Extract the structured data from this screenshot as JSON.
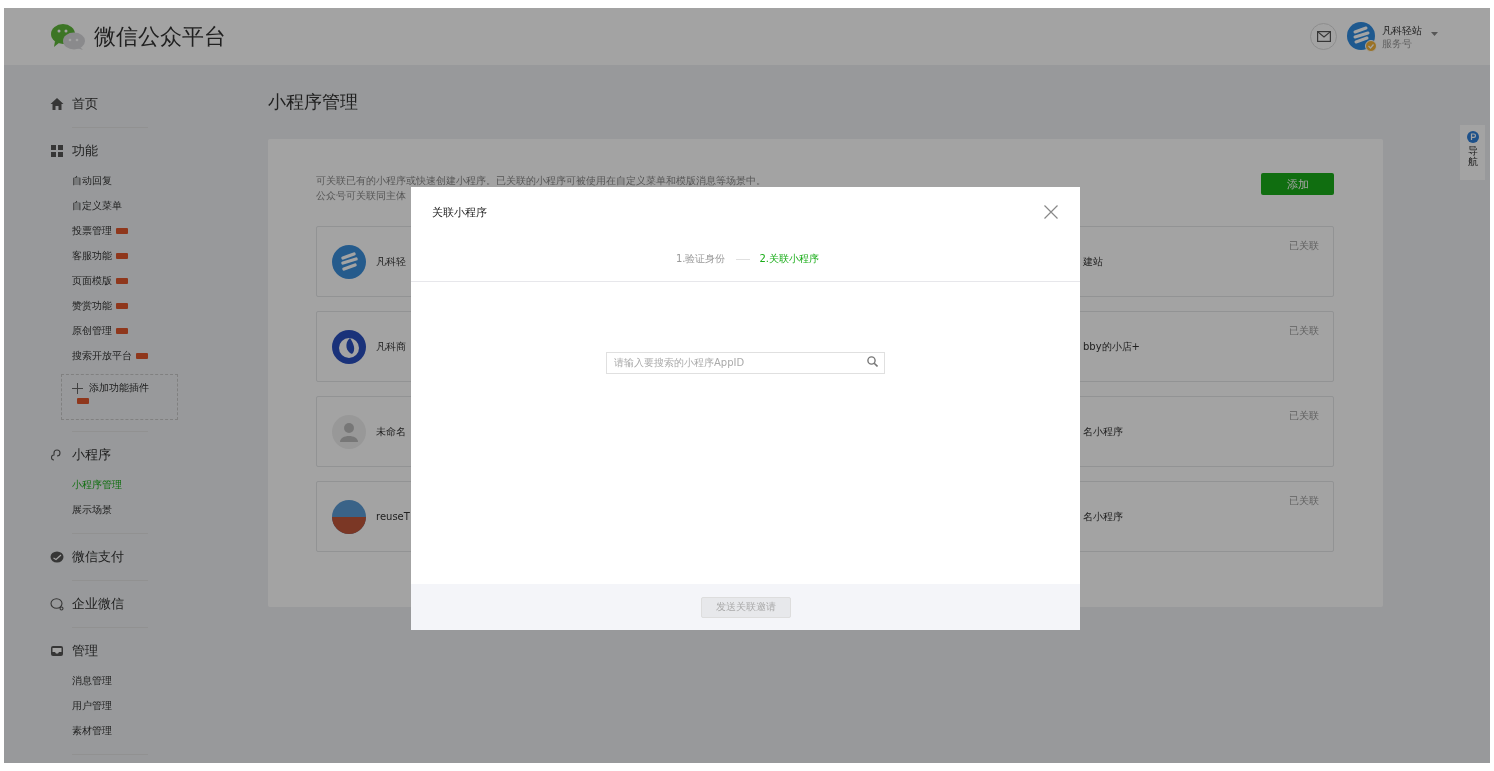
{
  "header": {
    "title": "微信公众平台",
    "account": {
      "name": "凡科轻站",
      "type": "服务号"
    }
  },
  "sidebar": [
    {
      "label": "首页"
    },
    {
      "label": "功能",
      "items": [
        {
          "label": "自动回复",
          "selected": false,
          "new": false
        },
        {
          "label": "自定义菜单",
          "selected": false,
          "new": false
        },
        {
          "label": "投票管理",
          "selected": false,
          "new": true
        },
        {
          "label": "客服功能",
          "selected": false,
          "new": true
        },
        {
          "label": "页面模版",
          "selected": false,
          "new": true
        },
        {
          "label": "赞赏功能",
          "selected": false,
          "new": true
        },
        {
          "label": "原创管理",
          "selected": false,
          "new": true
        },
        {
          "label": "搜索开放平台",
          "selected": false,
          "new": true
        }
      ],
      "plugin_button": {
        "label": "添加功能插件",
        "new": true
      }
    },
    {
      "label": "小程序",
      "items": [
        {
          "label": "小程序管理",
          "selected": true,
          "new": false
        },
        {
          "label": "展示场景",
          "selected": false,
          "new": false
        }
      ]
    },
    {
      "label": "微信支付"
    },
    {
      "label": "企业微信"
    },
    {
      "label": "管理",
      "items": [
        {
          "label": "消息管理",
          "selected": false,
          "new": false
        },
        {
          "label": "用户管理",
          "selected": false,
          "new": false
        },
        {
          "label": "素材管理",
          "selected": false,
          "new": false
        }
      ]
    }
  ],
  "main": {
    "title": "小程序管理",
    "intro": [
      "可关联已有的小程序或快速创建小程序。已关联的小程序可被使用在自定义菜单和模版消息等场景中。",
      "公众号可关联同主体"
    ],
    "add_button": "添加",
    "cards": [
      {
        "kind": "logo-s",
        "left_name": "凡科轻",
        "right_name": "建站",
        "status": "已关联"
      },
      {
        "kind": "logo-swirl",
        "left_name": "凡科商",
        "right_name": "bby的小店+",
        "status": "已关联"
      },
      {
        "kind": "default",
        "left_name": "未命名",
        "right_name": "名小程序",
        "status": "已关联"
      },
      {
        "kind": "photo",
        "left_name": "reuseT",
        "right_name": "名小程序",
        "status": "已关联"
      }
    ]
  },
  "side_nav": {
    "label": "导航"
  },
  "modal": {
    "title": "关联小程序",
    "steps": [
      {
        "label": "1.验证身份",
        "selected": false
      },
      {
        "label": "2.关联小程序",
        "selected": true
      }
    ],
    "search": {
      "placeholder": "请输入要搜索的小程序AppID"
    },
    "submit": {
      "label": "发送关联邀请",
      "disabled": true
    }
  }
}
